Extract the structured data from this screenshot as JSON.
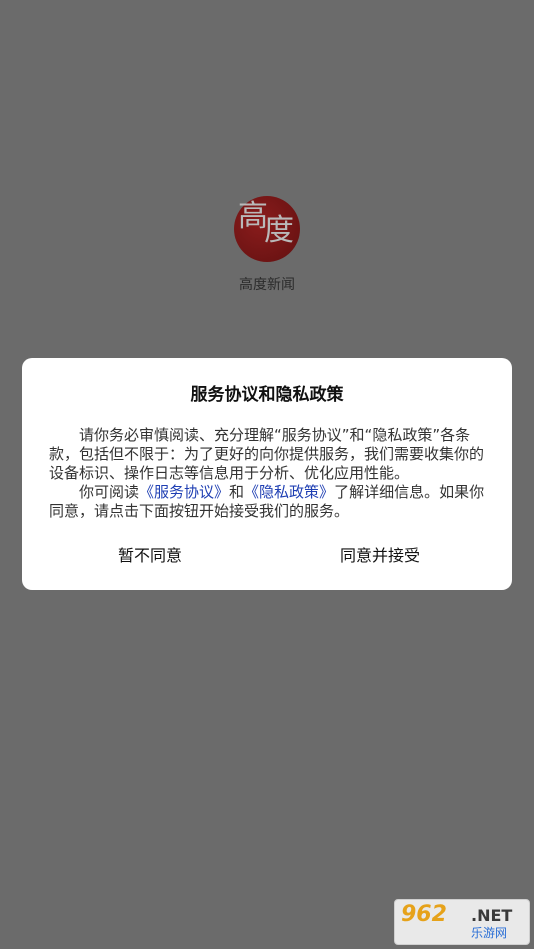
{
  "app": {
    "logo_char_1": "高",
    "logo_char_2": "度",
    "name": "高度新闻"
  },
  "dialog": {
    "title": "服务协议和隐私政策",
    "para1": "请你务必审慎阅读、充分理解“服务协议”和“隐私政策”各条款，包括但不限于：为了更好的向你提供服务，我们需要收集你的设备标识、操作日志等信息用于分析、优化应用性能。",
    "para2_prefix": "你可阅读",
    "link_service": "《服务协议》",
    "para2_and": "和",
    "link_privacy": "《隐私政策》",
    "para2_suffix": "了解详细信息。如果你同意，请点击下面按钮开始接受我们的服务。",
    "disagree_label": "暂不同意",
    "agree_label": "同意并接受"
  },
  "watermark": {
    "number": "962",
    "suffix": ".NET",
    "cn": "乐游网"
  },
  "colors": {
    "overlay": "#6b6b6b",
    "link": "#1f3fb3",
    "logo": "#7a1818"
  }
}
